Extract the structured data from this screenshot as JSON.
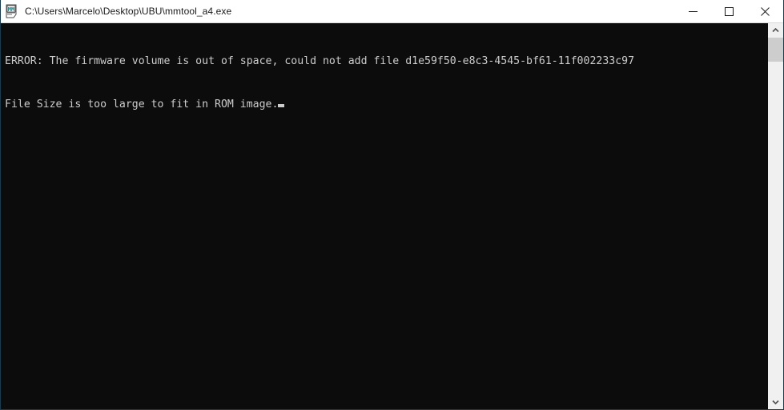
{
  "window": {
    "title": "C:\\Users\\Marcelo\\Desktop\\UBU\\mmtool_a4.exe",
    "icon": "mmtool-app-icon",
    "background_color": "#0c0c0c",
    "titlebar_color": "#ffffff",
    "border_color": "#1b3a4b"
  },
  "controls": {
    "minimize": "minimize-icon",
    "maximize": "maximize-icon",
    "close": "close-icon"
  },
  "console": {
    "text_color": "#cccccc",
    "lines": [
      "ERROR: The firmware volume is out of space, could not add file d1e59f50-e8c3-4545-bf61-11f002233c97",
      "File Size is too large to fit in ROM image."
    ],
    "error_guid": "d1e59f50-e8c3-4545-bf61-11f002233c97",
    "cursor_visible": true,
    "partial_bottom_line": "                    _      _       _         _          _         _        _    _"
  },
  "scrollbar": {
    "up_arrow": "chevron-up-icon",
    "down_arrow": "chevron-down-icon",
    "thumb_color": "#cdcdcd",
    "track_color": "#f0f0f0"
  }
}
